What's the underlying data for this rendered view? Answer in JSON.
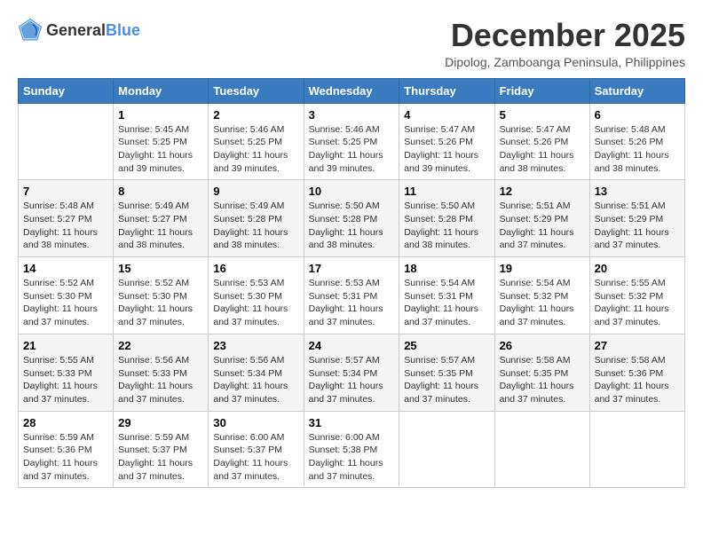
{
  "logo": {
    "general": "General",
    "blue": "Blue"
  },
  "title": "December 2025",
  "subtitle": "Dipolog, Zamboanga Peninsula, Philippines",
  "headers": [
    "Sunday",
    "Monday",
    "Tuesday",
    "Wednesday",
    "Thursday",
    "Friday",
    "Saturday"
  ],
  "weeks": [
    [
      {
        "day": "",
        "sunrise": "",
        "sunset": "",
        "daylight": ""
      },
      {
        "day": "1",
        "sunrise": "Sunrise: 5:45 AM",
        "sunset": "Sunset: 5:25 PM",
        "daylight": "Daylight: 11 hours and 39 minutes."
      },
      {
        "day": "2",
        "sunrise": "Sunrise: 5:46 AM",
        "sunset": "Sunset: 5:25 PM",
        "daylight": "Daylight: 11 hours and 39 minutes."
      },
      {
        "day": "3",
        "sunrise": "Sunrise: 5:46 AM",
        "sunset": "Sunset: 5:25 PM",
        "daylight": "Daylight: 11 hours and 39 minutes."
      },
      {
        "day": "4",
        "sunrise": "Sunrise: 5:47 AM",
        "sunset": "Sunset: 5:26 PM",
        "daylight": "Daylight: 11 hours and 39 minutes."
      },
      {
        "day": "5",
        "sunrise": "Sunrise: 5:47 AM",
        "sunset": "Sunset: 5:26 PM",
        "daylight": "Daylight: 11 hours and 38 minutes."
      },
      {
        "day": "6",
        "sunrise": "Sunrise: 5:48 AM",
        "sunset": "Sunset: 5:26 PM",
        "daylight": "Daylight: 11 hours and 38 minutes."
      }
    ],
    [
      {
        "day": "7",
        "sunrise": "Sunrise: 5:48 AM",
        "sunset": "Sunset: 5:27 PM",
        "daylight": "Daylight: 11 hours and 38 minutes."
      },
      {
        "day": "8",
        "sunrise": "Sunrise: 5:49 AM",
        "sunset": "Sunset: 5:27 PM",
        "daylight": "Daylight: 11 hours and 38 minutes."
      },
      {
        "day": "9",
        "sunrise": "Sunrise: 5:49 AM",
        "sunset": "Sunset: 5:28 PM",
        "daylight": "Daylight: 11 hours and 38 minutes."
      },
      {
        "day": "10",
        "sunrise": "Sunrise: 5:50 AM",
        "sunset": "Sunset: 5:28 PM",
        "daylight": "Daylight: 11 hours and 38 minutes."
      },
      {
        "day": "11",
        "sunrise": "Sunrise: 5:50 AM",
        "sunset": "Sunset: 5:28 PM",
        "daylight": "Daylight: 11 hours and 38 minutes."
      },
      {
        "day": "12",
        "sunrise": "Sunrise: 5:51 AM",
        "sunset": "Sunset: 5:29 PM",
        "daylight": "Daylight: 11 hours and 37 minutes."
      },
      {
        "day": "13",
        "sunrise": "Sunrise: 5:51 AM",
        "sunset": "Sunset: 5:29 PM",
        "daylight": "Daylight: 11 hours and 37 minutes."
      }
    ],
    [
      {
        "day": "14",
        "sunrise": "Sunrise: 5:52 AM",
        "sunset": "Sunset: 5:30 PM",
        "daylight": "Daylight: 11 hours and 37 minutes."
      },
      {
        "day": "15",
        "sunrise": "Sunrise: 5:52 AM",
        "sunset": "Sunset: 5:30 PM",
        "daylight": "Daylight: 11 hours and 37 minutes."
      },
      {
        "day": "16",
        "sunrise": "Sunrise: 5:53 AM",
        "sunset": "Sunset: 5:30 PM",
        "daylight": "Daylight: 11 hours and 37 minutes."
      },
      {
        "day": "17",
        "sunrise": "Sunrise: 5:53 AM",
        "sunset": "Sunset: 5:31 PM",
        "daylight": "Daylight: 11 hours and 37 minutes."
      },
      {
        "day": "18",
        "sunrise": "Sunrise: 5:54 AM",
        "sunset": "Sunset: 5:31 PM",
        "daylight": "Daylight: 11 hours and 37 minutes."
      },
      {
        "day": "19",
        "sunrise": "Sunrise: 5:54 AM",
        "sunset": "Sunset: 5:32 PM",
        "daylight": "Daylight: 11 hours and 37 minutes."
      },
      {
        "day": "20",
        "sunrise": "Sunrise: 5:55 AM",
        "sunset": "Sunset: 5:32 PM",
        "daylight": "Daylight: 11 hours and 37 minutes."
      }
    ],
    [
      {
        "day": "21",
        "sunrise": "Sunrise: 5:55 AM",
        "sunset": "Sunset: 5:33 PM",
        "daylight": "Daylight: 11 hours and 37 minutes."
      },
      {
        "day": "22",
        "sunrise": "Sunrise: 5:56 AM",
        "sunset": "Sunset: 5:33 PM",
        "daylight": "Daylight: 11 hours and 37 minutes."
      },
      {
        "day": "23",
        "sunrise": "Sunrise: 5:56 AM",
        "sunset": "Sunset: 5:34 PM",
        "daylight": "Daylight: 11 hours and 37 minutes."
      },
      {
        "day": "24",
        "sunrise": "Sunrise: 5:57 AM",
        "sunset": "Sunset: 5:34 PM",
        "daylight": "Daylight: 11 hours and 37 minutes."
      },
      {
        "day": "25",
        "sunrise": "Sunrise: 5:57 AM",
        "sunset": "Sunset: 5:35 PM",
        "daylight": "Daylight: 11 hours and 37 minutes."
      },
      {
        "day": "26",
        "sunrise": "Sunrise: 5:58 AM",
        "sunset": "Sunset: 5:35 PM",
        "daylight": "Daylight: 11 hours and 37 minutes."
      },
      {
        "day": "27",
        "sunrise": "Sunrise: 5:58 AM",
        "sunset": "Sunset: 5:36 PM",
        "daylight": "Daylight: 11 hours and 37 minutes."
      }
    ],
    [
      {
        "day": "28",
        "sunrise": "Sunrise: 5:59 AM",
        "sunset": "Sunset: 5:36 PM",
        "daylight": "Daylight: 11 hours and 37 minutes."
      },
      {
        "day": "29",
        "sunrise": "Sunrise: 5:59 AM",
        "sunset": "Sunset: 5:37 PM",
        "daylight": "Daylight: 11 hours and 37 minutes."
      },
      {
        "day": "30",
        "sunrise": "Sunrise: 6:00 AM",
        "sunset": "Sunset: 5:37 PM",
        "daylight": "Daylight: 11 hours and 37 minutes."
      },
      {
        "day": "31",
        "sunrise": "Sunrise: 6:00 AM",
        "sunset": "Sunset: 5:38 PM",
        "daylight": "Daylight: 11 hours and 37 minutes."
      },
      {
        "day": "",
        "sunrise": "",
        "sunset": "",
        "daylight": ""
      },
      {
        "day": "",
        "sunrise": "",
        "sunset": "",
        "daylight": ""
      },
      {
        "day": "",
        "sunrise": "",
        "sunset": "",
        "daylight": ""
      }
    ]
  ]
}
